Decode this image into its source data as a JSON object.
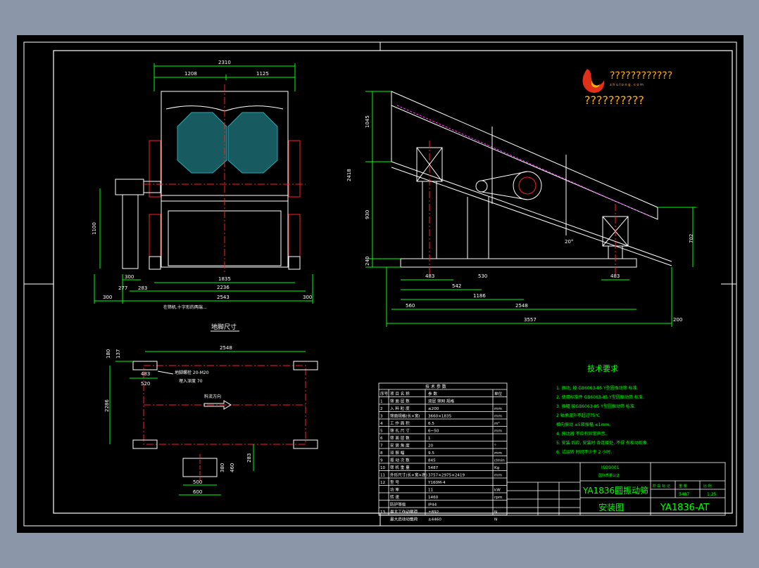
{
  "colors": {
    "background": "#8b96a8",
    "sheet": "#000000",
    "frame": "#ffffff",
    "dimension": "#00ff00",
    "centerline": "#ff2020",
    "cyan_hatch": "#2aa6b0",
    "magenta": "#ff40ff",
    "logo_red": "#e03018",
    "logo_text": "#ffb000"
  },
  "logo": {
    "line1": "????????????",
    "line2": "z h u l o n g . c o m",
    "line3": "??????????"
  },
  "front_view": {
    "dims": [
      "2310",
      "1208",
      "1125",
      "1100",
      "300",
      "277",
      "283",
      "1835",
      "2236",
      "2543",
      "300",
      "300"
    ],
    "note": "在筛机.十字形的两端..."
  },
  "side_view": {
    "dims_left": [
      "1045",
      "2418",
      "930",
      "240"
    ],
    "dims_right": [
      "702"
    ],
    "dims_bottom": [
      "483",
      "542",
      "530",
      "1186",
      "483",
      "560",
      "2548",
      "3557",
      "200"
    ],
    "angle": "20°"
  },
  "foundation": {
    "title": "地脚尺寸",
    "dims": [
      "2548",
      "180",
      "137",
      "483",
      "520",
      "2286",
      "283",
      "500",
      "600",
      "380",
      "460"
    ],
    "bolt_note_1": "地脚螺栓 20-M20",
    "bolt_note_2": "埋入深度 70",
    "flow_label": "料流方向"
  },
  "tech_requirements": {
    "title": "技术要求",
    "items": [
      "1. 振动, 按 GB6063-85 Y型圆振动筛 标准.",
      "2. 使用标准件 GB6063-85 Y型圆振动筛 标准.",
      "3. 振幅 按GB6063-85 Y型圆振动筛 标准.",
      "   2 轴承温升不超过75℃",
      "   横向振动 ≤5双振幅 ≤1mm.",
      "4. 振动器 不应有异常声音.",
      "5. 安装 后应, 安装时 各连接处, 不得 有松动现象.",
      "6. 试运转 时间不少于 2 小时."
    ]
  },
  "spec_table": {
    "title": "技 术 参 数",
    "rows": [
      {
        "no": "序号",
        "name": "项 目 名 称",
        "value": "参 数",
        "unit": "单位"
      },
      {
        "no": "1",
        "name": "筛 面 层 数",
        "value": "双层 筛网 规格",
        "unit": ""
      },
      {
        "no": "2",
        "name": "入 料 粒 度",
        "value": "≤200",
        "unit": "mm"
      },
      {
        "no": "3",
        "name": "筛面规格(长×宽)",
        "value": "3660×1835",
        "unit": "mm"
      },
      {
        "no": "4",
        "name": "工 作 面 积",
        "value": "6.5",
        "unit": "m²"
      },
      {
        "no": "5",
        "name": "筛 孔 尺 寸",
        "value": "6~50",
        "unit": "mm"
      },
      {
        "no": "6",
        "name": "筛 面 层 数",
        "value": "1",
        "unit": ""
      },
      {
        "no": "7",
        "name": "安 装 角 度",
        "value": "20",
        "unit": "°"
      },
      {
        "no": "8",
        "name": "双 振 幅",
        "value": "9.5",
        "unit": "mm"
      },
      {
        "no": "9",
        "name": "振 动 次 数",
        "value": "845",
        "unit": "r/min"
      },
      {
        "no": "10",
        "name": "筛 机 重 量",
        "value": "5487",
        "unit": "Kg"
      },
      {
        "no": "11",
        "name": "外形尺寸(长×宽×高)",
        "value": "3757×2975×2419",
        "unit": "mm"
      },
      {
        "no": "12",
        "name": "型 号",
        "value": "Y160M-4",
        "unit": ""
      },
      {
        "no": "",
        "name": "功 率",
        "value": "11",
        "unit": "kW"
      },
      {
        "no": "",
        "name": "转 速",
        "value": "1460",
        "unit": "rpm"
      },
      {
        "no": "",
        "name": "防护等级",
        "value": "IP44",
        "unit": ""
      },
      {
        "no": "13",
        "name": "最大工作动载荷",
        "value": "±892",
        "unit": "N"
      },
      {
        "no": "",
        "name": "最大启动动载荷",
        "value": "±4460",
        "unit": "N"
      }
    ]
  },
  "title_block": {
    "iso": "ISO9001",
    "iso_sub": "国际质量认证",
    "product": "YA1836圆振动筛",
    "drawing_type": "安装图",
    "code": "YA1836-AT",
    "scale": "1:25",
    "weight": "5487",
    "headers": [
      "阶 段 标 记",
      "重 量",
      "比 例"
    ]
  }
}
